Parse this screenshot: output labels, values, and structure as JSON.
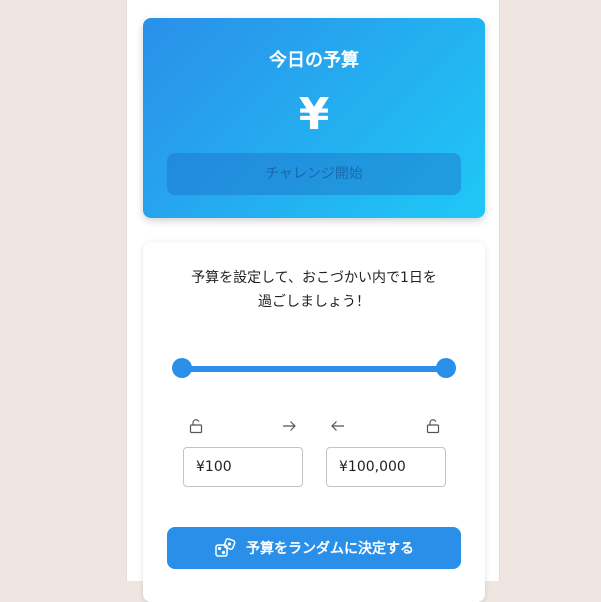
{
  "budget_card": {
    "title": "今日の予算",
    "amount": "¥",
    "challenge_label": "チャレンジ開始"
  },
  "setup": {
    "description_line1": "予算を設定して、おこづかい内で1日を",
    "description_line2": "過ごしましょう！",
    "range": {
      "min_value": "¥100",
      "max_value": "¥100,000",
      "slider_min_fraction": 0,
      "slider_max_fraction": 1
    },
    "random_button_label": "予算をランダムに決定する"
  },
  "icons": {
    "lock_min": "unlock-icon",
    "arrow_right": "arrow-right-icon",
    "arrow_left": "arrow-left-icon",
    "lock_max": "unlock-icon",
    "dice": "dice-icon"
  },
  "colors": {
    "accent": "#2a8fe9",
    "gradient_end": "#1fc8f6",
    "background": "#efe6e1"
  }
}
